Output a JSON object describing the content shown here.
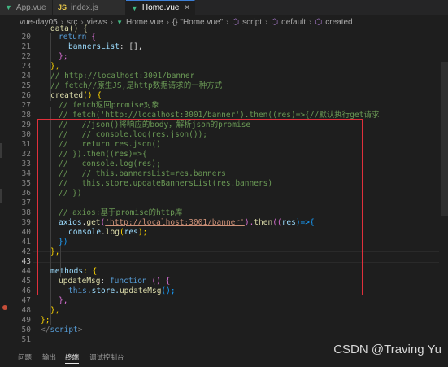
{
  "tabs": [
    {
      "label": "App.vue",
      "icon": "vue-file-icon",
      "active": false
    },
    {
      "label": "index.js",
      "icon": "js-file-icon",
      "active": false
    },
    {
      "label": "Home.vue",
      "icon": "vue-file-icon",
      "active": true
    }
  ],
  "close_glyph": "×",
  "breadcrumb": [
    "vue-day05",
    "src",
    "views",
    "Home.vue",
    "{} \"Home.vue\"",
    "script",
    "default",
    "created"
  ],
  "line_numbers": [
    "20",
    "21",
    "22",
    "23",
    "24",
    "25",
    "26",
    "27",
    "28",
    "29",
    "30",
    "31",
    "32",
    "33",
    "34",
    "35",
    "36",
    "37",
    "38",
    "39",
    "40",
    "41",
    "42",
    "43",
    "44",
    "45",
    "46",
    "47",
    "48",
    "49",
    "50",
    "51"
  ],
  "current_line": "39",
  "code": {
    "l19": "data() {",
    "l20_kw": "return",
    "l20_b": "{",
    "l21_p": "bannersList",
    "l21_rest": ": [],",
    "l22": "};",
    "l23": "},",
    "l24": "// http://localhost:3001/banner",
    "l25": "// fetch//原生JS,是http数据请求的一种方式",
    "l26_fn": "created",
    "l26_rest": "() {",
    "l27": "// fetch返回promise对象",
    "l28": "// fetch('http://localhost:3001/banner').then((res)=>{//默认执行get请求",
    "l29": "//   //json()将响应的body，解析json的promise",
    "l30": "//   // console.log(res.json());",
    "l31": "//   return res.json()",
    "l32": "// }).then((res)=>{",
    "l33": "//   console.log(res);",
    "l34": "//   // this.bannersList=res.banners",
    "l35": "//   this.store.updateBannersList(res.banners)",
    "l36": "// })",
    "l37": "",
    "l38": "// axios:基于promise的http库",
    "l39_obj": "axios",
    "l39_dot": ".",
    "l39_fn": "get",
    "l39_p1": "(",
    "l39_str": "'http://localhost:3001/banner'",
    "l39_p2": ").",
    "l39_fn2": "then",
    "l39_p3": "((",
    "l39_res": "res",
    "l39_p4": ")=>{",
    "l40_obj": "console",
    "l40_dot": ".",
    "l40_fn": "log",
    "l40_p1": "(",
    "l40_res": "res",
    "l40_p2": ");",
    "l41": "})",
    "l42": "},",
    "l43": "",
    "l44_p": "methods",
    "l44_rest": ": {",
    "l45_fn": "updateMsg",
    "l45_c": ": ",
    "l45_kw": "function",
    "l45_rest": " () {",
    "l46_kw": "this",
    "l46_p": ".store.",
    "l46_fn": "updateMsg",
    "l46_rest": "();",
    "l47": "},",
    "l48": "},",
    "l49": "};",
    "l50_open": "</",
    "l50_tag": "script",
    "l50_close": ">"
  },
  "panel_tabs": [
    "问题",
    "输出",
    "终端",
    "调试控制台"
  ],
  "active_panel_tab": "终端",
  "watermark": "CSDN @Traving Yu",
  "colors": {
    "background": "#1e1e1e",
    "highlight_box": "#e0303b",
    "keyword": "#569cd6",
    "string": "#ce9178",
    "comment": "#6a9955",
    "function": "#dcdcaa"
  }
}
